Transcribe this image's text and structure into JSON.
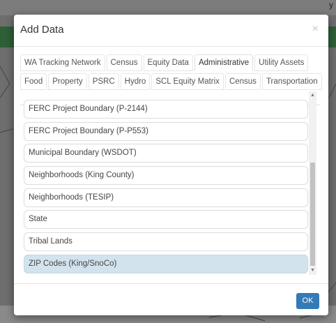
{
  "background": {
    "topright_text": "y"
  },
  "dialog": {
    "title": "Add Data",
    "close_glyph": "×"
  },
  "tabs": {
    "row1": [
      {
        "label": "WA Tracking Network"
      },
      {
        "label": "Census"
      },
      {
        "label": "Equity Data"
      },
      {
        "label": "Administrative",
        "active": true
      },
      {
        "label": "Utility Assets"
      }
    ],
    "row2": [
      {
        "label": "Food"
      },
      {
        "label": "Property"
      },
      {
        "label": "PSRC"
      },
      {
        "label": "Hydro"
      },
      {
        "label": "SCL Equity Matrix"
      },
      {
        "label": "Census"
      },
      {
        "label": "Transportation"
      }
    ]
  },
  "layers": [
    {
      "label": "FERC Project Boundary (P-2144)"
    },
    {
      "label": "FERC Project Boundary (P-P553)"
    },
    {
      "label": "Municipal Boundary (WSDOT)"
    },
    {
      "label": "Neighborhoods (King County)"
    },
    {
      "label": "Neighborhoods (TESIP)"
    },
    {
      "label": "State"
    },
    {
      "label": "Tribal Lands"
    },
    {
      "label": "ZIP Codes (King/SnoCo)",
      "selected": true
    }
  ],
  "scroll": {
    "up_glyph": "▲",
    "down_glyph": "▼"
  },
  "footer": {
    "ok_label": "OK"
  },
  "colors": {
    "accent": "#337ab7",
    "selected_item": "#d2e3ee",
    "header_green": "#2e5f37"
  }
}
